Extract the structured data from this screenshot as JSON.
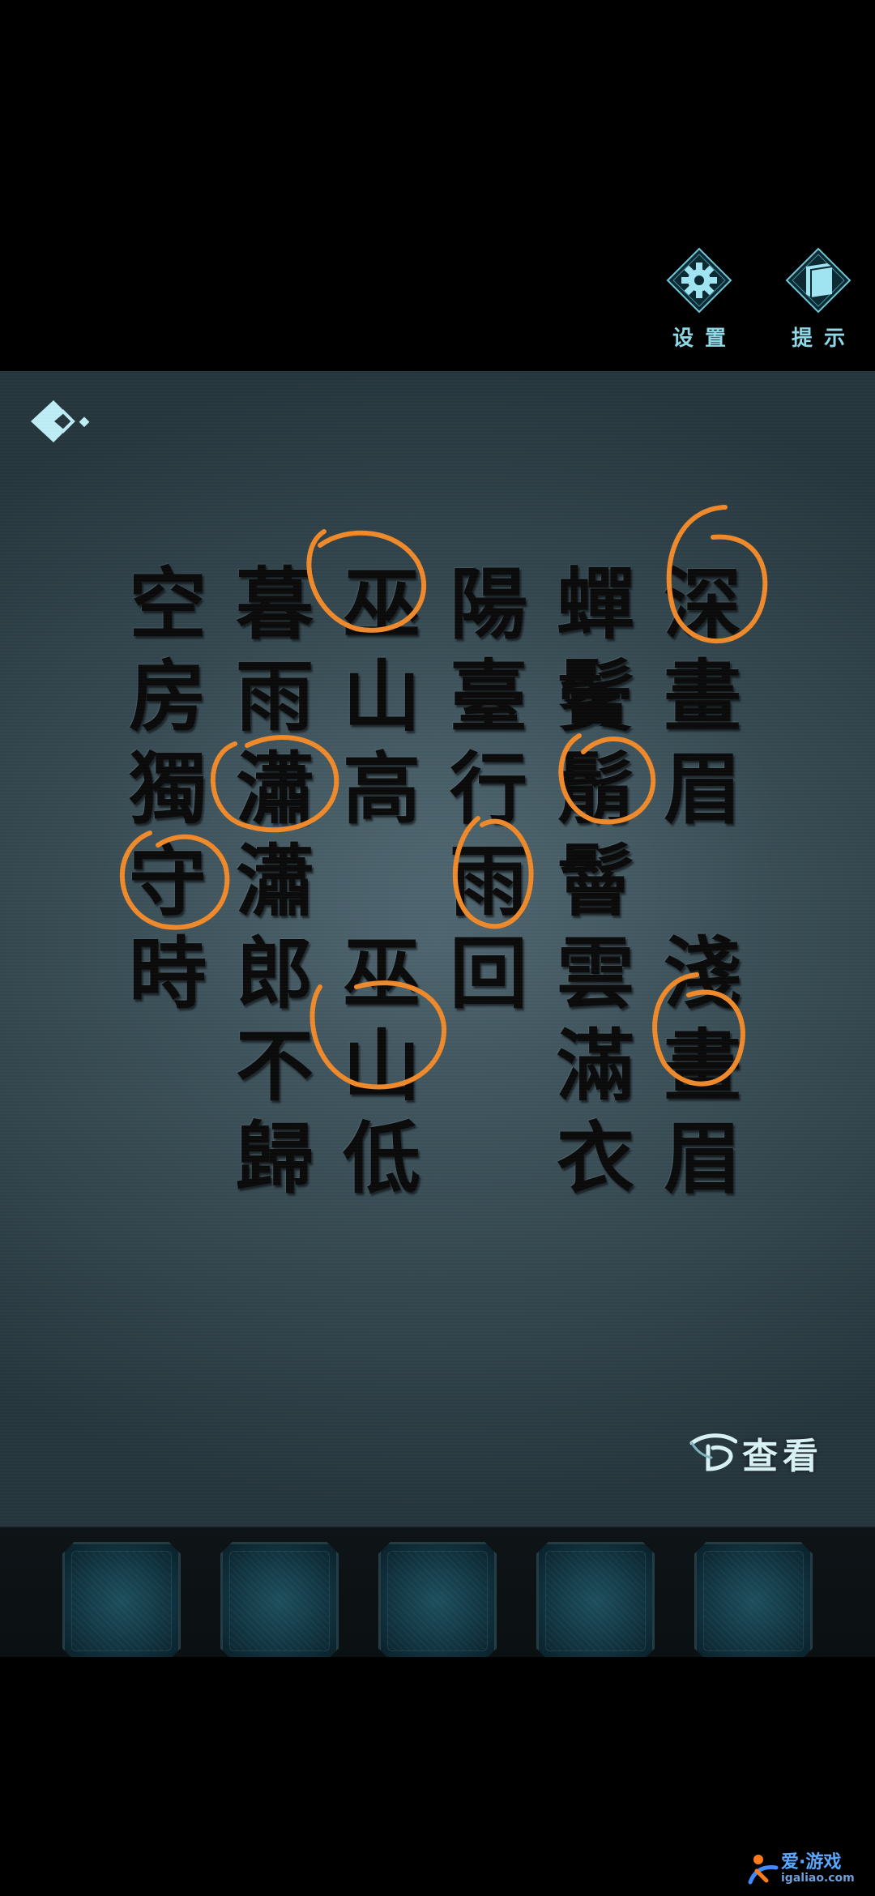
{
  "top_bar": {
    "settings_label": "设置",
    "hint_label": "提示"
  },
  "poem": {
    "columns": [
      [
        "深",
        "畫",
        "眉",
        " ",
        "淺",
        "畫",
        "眉"
      ],
      [
        "蟬",
        "鬢",
        "鬅",
        "鬙",
        "雲",
        "滿",
        "衣"
      ],
      [
        "陽",
        "臺",
        "行",
        "雨",
        "回"
      ],
      [
        "巫",
        "山",
        "高",
        " ",
        "巫",
        "山",
        "低"
      ],
      [
        "暮",
        "雨",
        "瀟",
        "瀟",
        "郎",
        "不",
        "歸"
      ],
      [
        "空",
        "房",
        "獨",
        "守",
        "時"
      ]
    ]
  },
  "view_button": {
    "label": "查看"
  },
  "inventory": {
    "slots": [
      "",
      "",
      "",
      "",
      ""
    ]
  },
  "watermark": {
    "text_top": "爱·游戏",
    "text_bottom": "igaliao.com"
  },
  "colors": {
    "accent": "#8fd8e6",
    "circle_annotation": "#f08a2a",
    "slot_fill": "#123643",
    "scene_bg": "#3c5059"
  }
}
